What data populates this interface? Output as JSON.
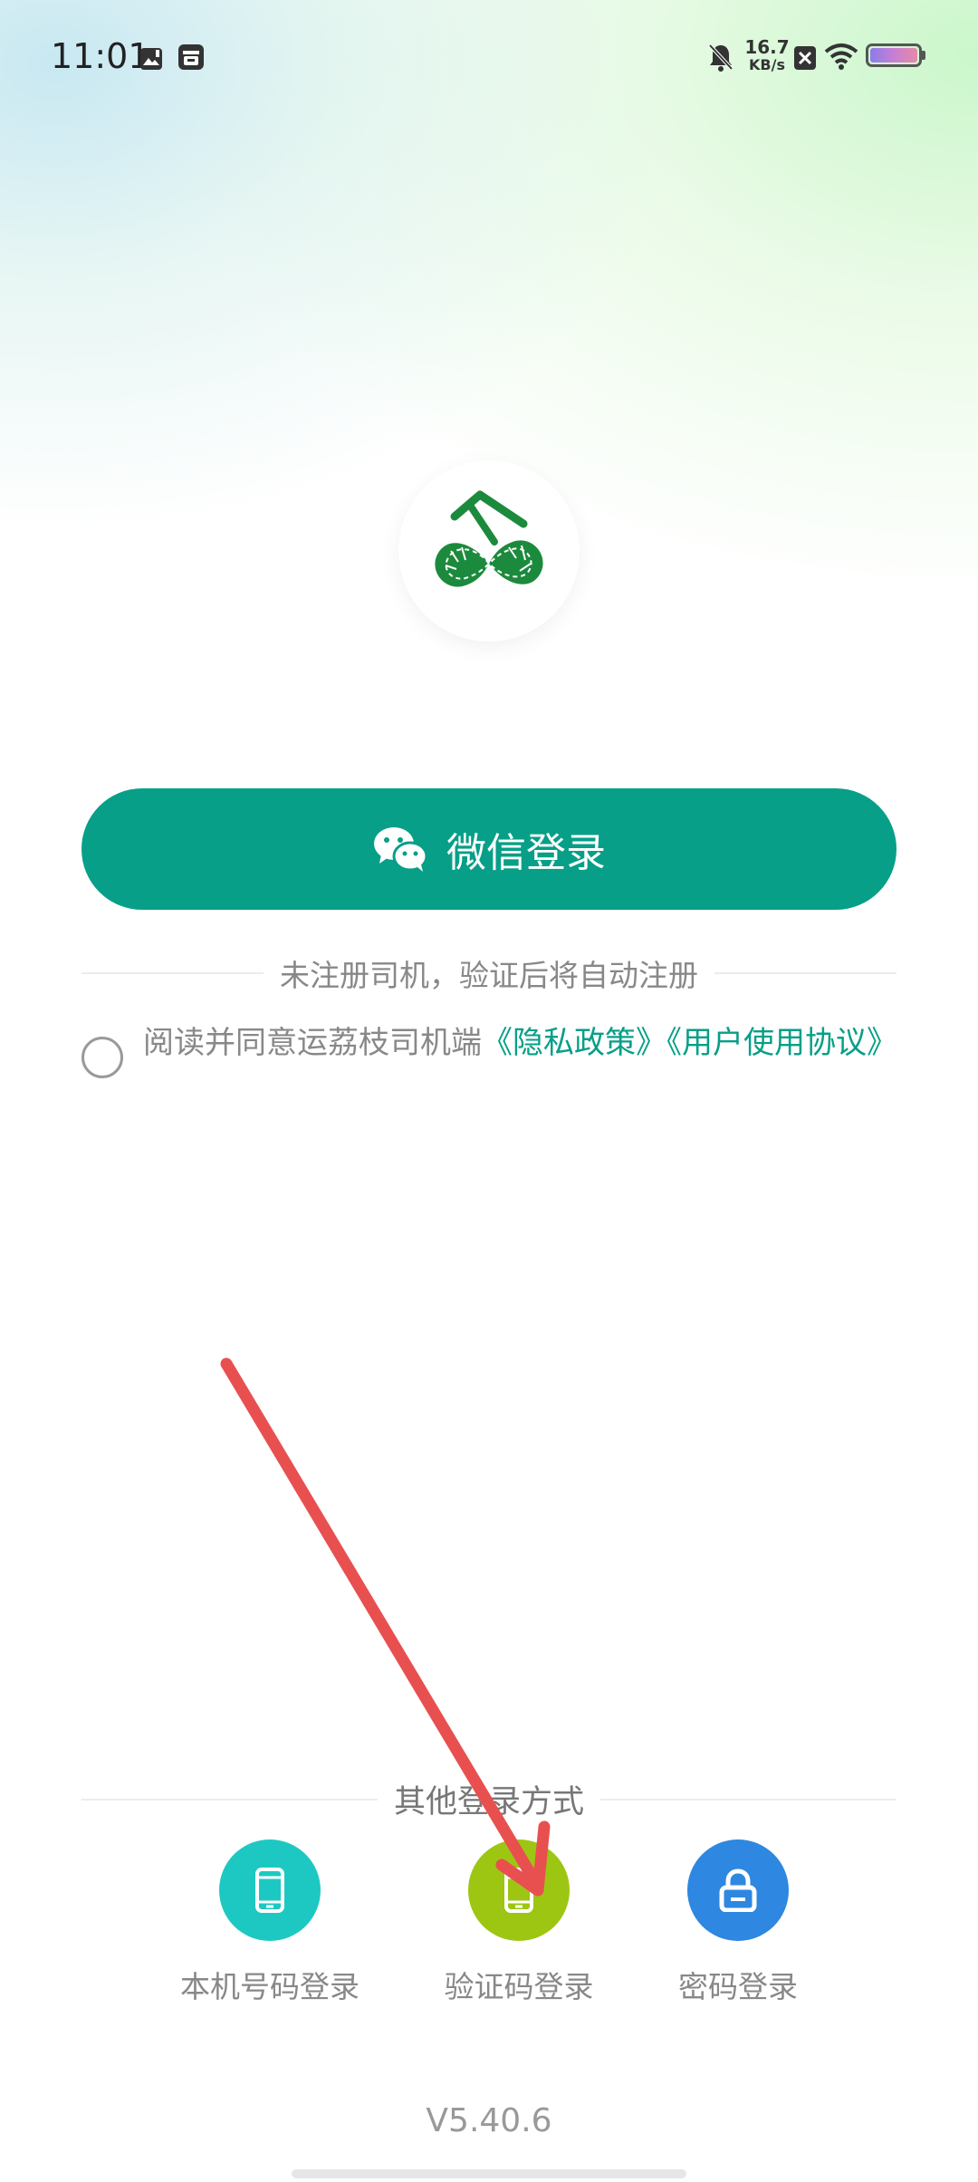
{
  "status_bar": {
    "time": "11:01",
    "net_speed_value": "16.7",
    "net_speed_unit": "KB/s"
  },
  "app": {
    "logo_icon": "litchi-logo-icon",
    "wechat_login_label": "微信登录",
    "auto_register_hint": "未注册司机，验证后将自动注册",
    "agreement": {
      "prefix": "阅读并同意运荔枝司机端",
      "privacy_link": "《隐私政策》",
      "terms_link": "《用户使用协议》"
    },
    "other_methods_title": "其他登录方式",
    "login_methods": [
      {
        "label": "本机号码登录",
        "icon": "phone-icon",
        "color": "#1ec8c2"
      },
      {
        "label": "验证码登录",
        "icon": "phone-icon",
        "color": "#9dc613"
      },
      {
        "label": "密码登录",
        "icon": "lock-icon",
        "color": "#2e87e0"
      }
    ],
    "version": "V5.40.6"
  },
  "colors": {
    "brand": "#079f87",
    "annotation_arrow": "#e85050"
  }
}
